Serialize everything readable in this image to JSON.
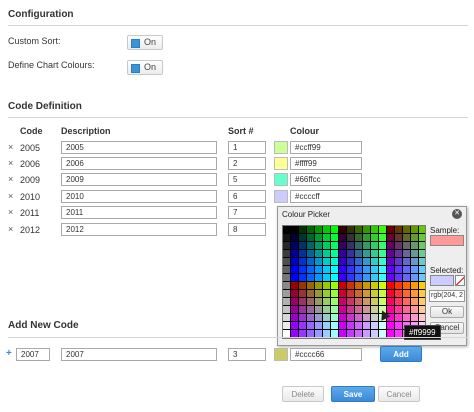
{
  "configuration": {
    "title": "Configuration",
    "custom_sort_label": "Custom Sort:",
    "custom_sort_state": "On",
    "define_colours_label": "Define Chart Colours:",
    "define_colours_state": "On"
  },
  "code_definition": {
    "title": "Code Definition",
    "columns": {
      "code": "Code",
      "description": "Description",
      "sort": "Sort #",
      "colour": "Colour"
    },
    "rows": [
      {
        "remove": "×",
        "code": "2005",
        "description": "2005",
        "sort": "1",
        "colour": "#ccff99",
        "swatch": "#ccff99"
      },
      {
        "remove": "×",
        "code": "2006",
        "description": "2006",
        "sort": "2",
        "colour": "#ffff99",
        "swatch": "#ffff99"
      },
      {
        "remove": "×",
        "code": "2009",
        "description": "2009",
        "sort": "5",
        "colour": "#66ffcc",
        "swatch": "#66ffcc"
      },
      {
        "remove": "×",
        "code": "2010",
        "description": "2010",
        "sort": "6",
        "colour": "#ccccff",
        "swatch": "#ccccff"
      },
      {
        "remove": "×",
        "code": "2011",
        "description": "2011",
        "sort": "7",
        "colour": "",
        "swatch": ""
      },
      {
        "remove": "×",
        "code": "2012",
        "description": "2012",
        "sort": "8",
        "colour": "",
        "swatch": ""
      }
    ]
  },
  "colour_picker": {
    "title": "Colour Picker",
    "sample_label": "Sample:",
    "sample_color": "#ff9999",
    "selected_label": "Selected:",
    "selected_color": "#ccccff",
    "rgb_value": "rgb(204, 2",
    "ok_label": "Ok",
    "cancel_label": "Cancel",
    "hover_tooltip": "#ff9999"
  },
  "add_new_code": {
    "title": "Add New Code",
    "plus": "+",
    "code_value": "2007",
    "description_value": "2007",
    "sort_value": "3",
    "colour_value": "#cccc66",
    "swatch": "#cccc66",
    "add_label": "Add"
  },
  "footer": {
    "delete_label": "Delete",
    "save_label": "Save",
    "cancel_label": "Cancel"
  }
}
